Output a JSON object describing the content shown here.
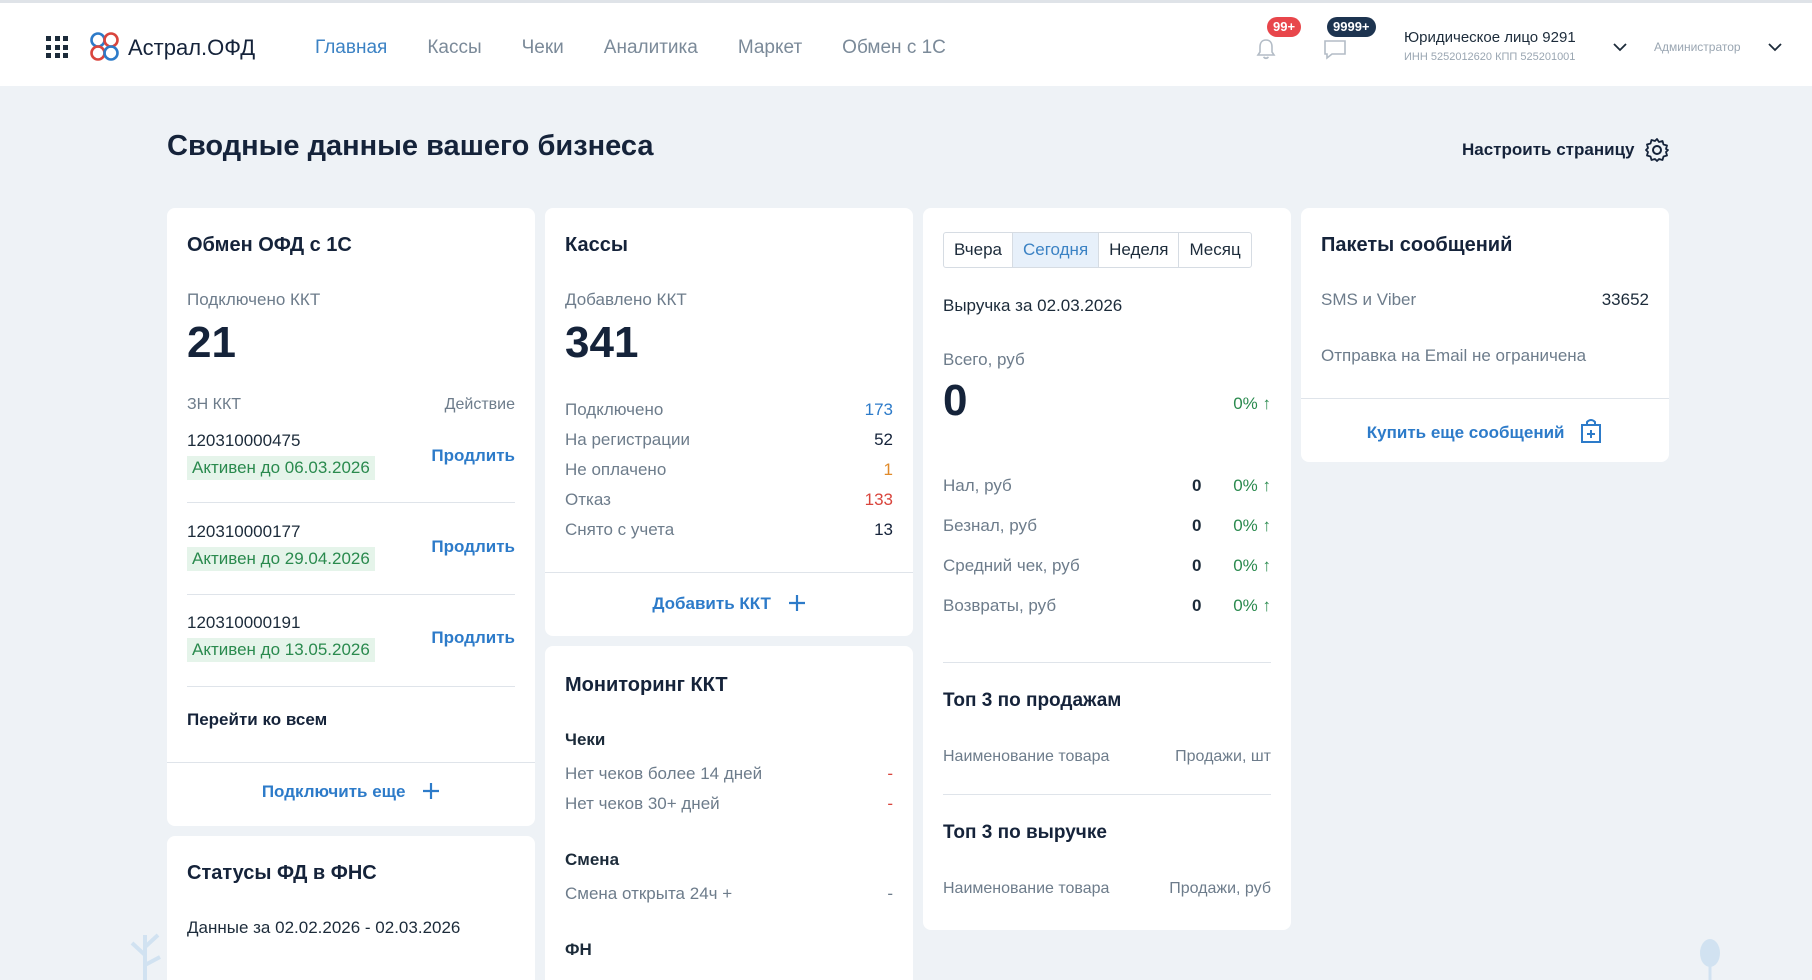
{
  "header": {
    "logo": "Астрал.ОФД",
    "nav": [
      "Главная",
      "Кассы",
      "Чеки",
      "Аналитика",
      "Маркет",
      "Обмен с 1С"
    ],
    "notifications_badge": "99+",
    "messages_badge": "9999+",
    "org_name": "Юридическое лицо 9291",
    "org_inn": "ИНН 5252012620  КПП 525201001",
    "role": "Администратор"
  },
  "page": {
    "title": "Сводные данные вашего бизнеса",
    "settings_label": "Настроить страницу"
  },
  "ofd": {
    "title": "Обмен ОФД с 1С",
    "connected_label": "Подключено ККТ",
    "connected_count": "21",
    "col_zn": "ЗН ККТ",
    "col_action": "Действие",
    "rows": [
      {
        "zn": "120310000475",
        "status": "Активен до 06.03.2026",
        "action": "Продлить"
      },
      {
        "zn": "120310000177",
        "status": "Активен до 29.04.2026",
        "action": "Продлить"
      },
      {
        "zn": "120310000191",
        "status": "Активен до 13.05.2026",
        "action": "Продлить"
      }
    ],
    "go_all": "Перейти ко всем",
    "connect_more": "Подключить еще"
  },
  "fns": {
    "title": "Статусы ФД в ФНС",
    "period": "Данные за 02.02.2026 - 02.03.2026"
  },
  "kassy": {
    "title": "Кассы",
    "added_label": "Добавлено ККТ",
    "added_count": "341",
    "stats": [
      {
        "label": "Подключено",
        "value": "173",
        "color": "#2d7bc9"
      },
      {
        "label": "На регистрации",
        "value": "52",
        "color": "#15233a"
      },
      {
        "label": "Не оплачено",
        "value": "1",
        "color": "#e08a2a"
      },
      {
        "label": "Отказ",
        "value": "133",
        "color": "#d9453d"
      },
      {
        "label": "Снято с учета",
        "value": "13",
        "color": "#15233a"
      }
    ],
    "add_label": "Добавить ККТ"
  },
  "monitoring": {
    "title": "Мониторинг ККТ",
    "section_checks": "Чеки",
    "checks": [
      {
        "label": "Нет чеков более 14 дней",
        "value": "-"
      },
      {
        "label": "Нет чеков 30+ дней",
        "value": "-"
      }
    ],
    "section_shift": "Смена",
    "shift": [
      {
        "label": "Смена открыта 24ч +",
        "value": "-"
      }
    ],
    "section_fn": "ФН"
  },
  "revenue": {
    "tabs": [
      "Вчера",
      "Сегодня",
      "Неделя",
      "Месяц"
    ],
    "active_tab": "Сегодня",
    "heading": "Выручка за 02.03.2026",
    "total_label": "Всего, руб",
    "total_value": "0",
    "total_change": "0% ↑",
    "rows": [
      {
        "label": "Нал, руб",
        "value": "0",
        "change": "0% ↑"
      },
      {
        "label": "Безнал, руб",
        "value": "0",
        "change": "0% ↑"
      },
      {
        "label": "Средний чек, руб",
        "value": "0",
        "change": "0% ↑"
      },
      {
        "label": "Возвраты, руб",
        "value": "0",
        "change": "0% ↑"
      }
    ],
    "top_sales_title": "Топ 3 по продажам",
    "top_sales_col1": "Наименование товара",
    "top_sales_col2": "Продажи, шт",
    "top_rev_title": "Топ 3 по выручке",
    "top_rev_col1": "Наименование товара",
    "top_rev_col2": "Продажи, руб"
  },
  "packages": {
    "title": "Пакеты сообщений",
    "sms_label": "SMS и Viber",
    "sms_value": "33652",
    "email_text": "Отправка на Email не ограничена",
    "buy_label": "Купить еще сообщений"
  }
}
